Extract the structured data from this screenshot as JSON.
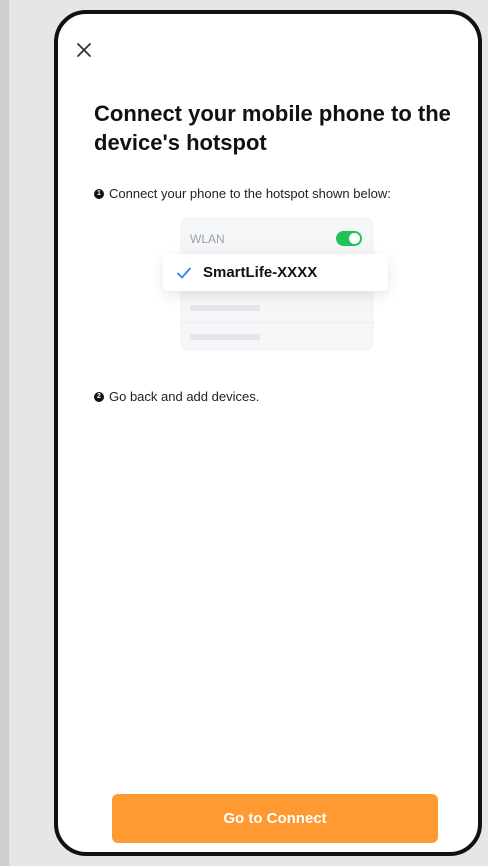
{
  "page": {
    "close_icon": "close-icon",
    "title": "Connect your mobile phone to the device's hotspot"
  },
  "steps": [
    {
      "number": "1",
      "text": "Connect your phone to the hotspot shown below:"
    },
    {
      "number": "2",
      "text": "Go back and add devices."
    }
  ],
  "illustration": {
    "wlan_label": "WLAN",
    "wlan_toggle_on": true,
    "selected_network": "SmartLife-XXXX",
    "check_icon": "check-icon"
  },
  "actions": {
    "connect_label": "Go to Connect"
  },
  "colors": {
    "primary": "#ff9a33",
    "toggle_on": "#22c25a",
    "check": "#3f7bf5",
    "background": "#e6e6e6"
  }
}
